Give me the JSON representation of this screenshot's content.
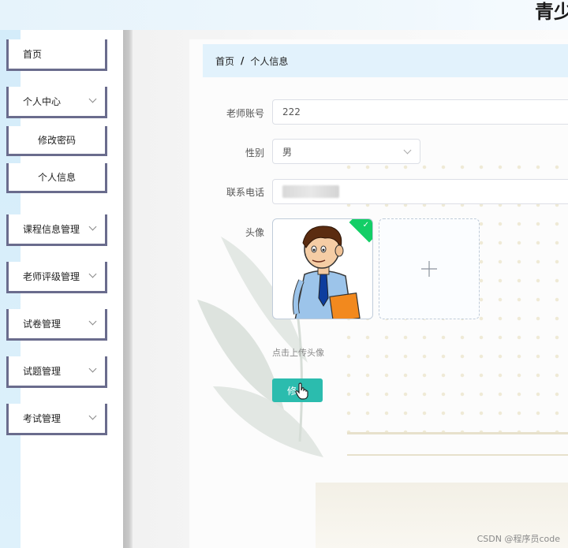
{
  "header": {
    "title": "青少"
  },
  "sidebar": {
    "items": [
      {
        "label": "首页"
      },
      {
        "label": "个人中心"
      },
      {
        "label": "修改密码"
      },
      {
        "label": "个人信息"
      },
      {
        "label": "课程信息管理"
      },
      {
        "label": "老师评级管理"
      },
      {
        "label": "试卷管理"
      },
      {
        "label": "试题管理"
      },
      {
        "label": "考试管理"
      }
    ]
  },
  "breadcrumb": {
    "home": "首页",
    "separator": "/",
    "current": "个人信息"
  },
  "form": {
    "account_label": "老师账号",
    "account_value": "222",
    "gender_label": "性别",
    "gender_value": "男",
    "phone_label": "联系电话",
    "avatar_label": "头像",
    "upload_hint": "点击上传头像",
    "submit_label": "修"
  },
  "watermark": "CSDN @程序员code",
  "colors": {
    "accent": "#2bbcae",
    "breadcrumb_bg": "#e2f2fc",
    "menu_border": "#6a6c8d",
    "success_corner": "#13ce66"
  },
  "icons": {
    "menu_expand": "chevron-down-icon",
    "upload": "plus-icon",
    "uploaded": "check-icon",
    "cursor": "hand-pointer-icon"
  }
}
